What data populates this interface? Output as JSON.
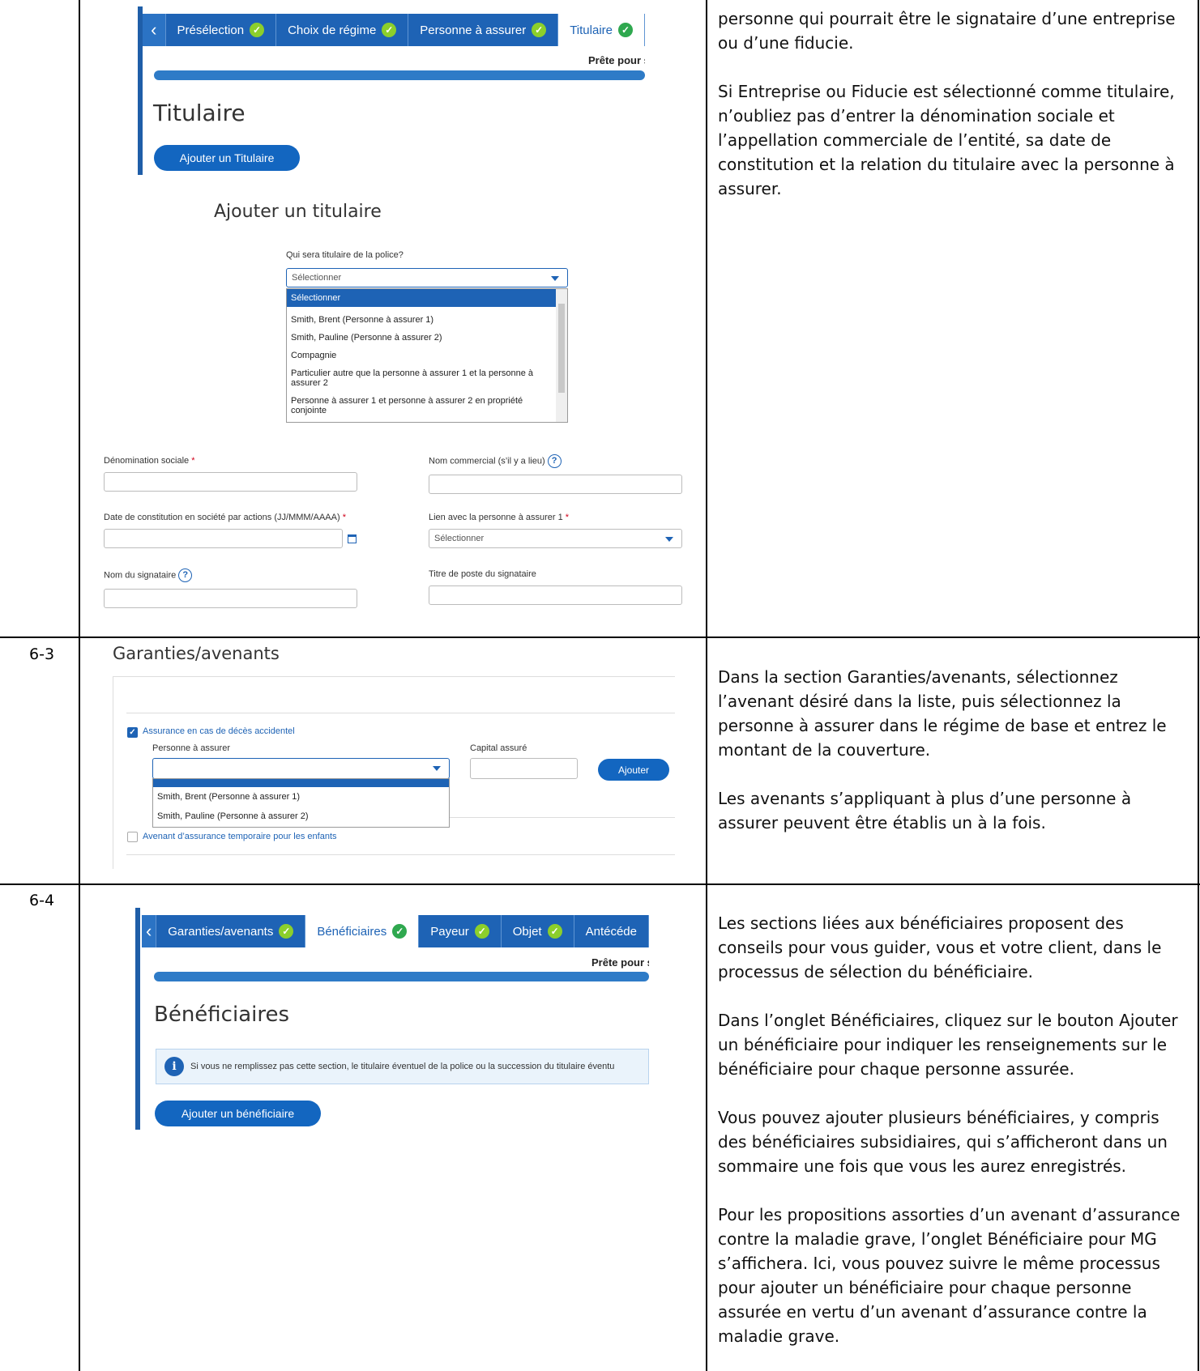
{
  "rows": [
    {
      "number": ""
    },
    {
      "number": "6-3"
    },
    {
      "number": "6-4"
    }
  ],
  "row1": {
    "desc": [
      "personne qui pourrait être le signataire d’une entreprise ou d’une fiducie.",
      "Si Entreprise ou Fiducie est sélectionné comme titulaire, n’oubliez pas d’entrer la dénomination sociale et l’appellation commerciale de l’entité, sa date de constitution et la relation du titulaire avec la personne à assurer."
    ],
    "tabs": [
      "Présélection",
      "Choix de régime",
      "Personne à assurer",
      "Titulaire"
    ],
    "ready": "Prête pour s",
    "page_title": "Titulaire",
    "add_button": "Ajouter un Titulaire",
    "modal_title": "Ajouter un titulaire",
    "question": "Qui sera titulaire de la police?",
    "select_value": "Sélectionner",
    "options": [
      "Sélectionner",
      "Smith, Brent (Personne à assurer 1)",
      "Smith, Pauline (Personne à assurer 2)",
      "Compagnie",
      "Particulier autre que la personne à assurer 1 et la personne à assurer 2",
      "Personne à assurer 1 et personne à assurer 2 en propriété conjointe"
    ],
    "fields": {
      "denomination": "Dénomination sociale",
      "nom_commercial": "Nom commercial (s’il y a lieu)",
      "date_constitution": "Date de constitution en société par actions (JJ/MMM/AAAA)",
      "lien": "Lien avec la personne à assurer 1",
      "lien_value": "Sélectionner",
      "nom_signataire": "Nom du signataire",
      "titre_poste": "Titre de poste du signataire"
    }
  },
  "row2": {
    "heading": "Garanties/avenants",
    "desc": [
      "Dans la section Garanties/avenants, sélectionnez l’avenant désiré dans la liste, puis sélectionnez la personne à assurer dans le régime de base et entrez le montant de la couverture.",
      "Les avenants s’appliquant à plus d’une personne à assurer peuvent être établis un à la fois."
    ],
    "rider1": "Assurance en cas de décès accidentel",
    "person_label": "Personne à assurer",
    "capital_label": "Capital assuré",
    "add_label": "Ajouter",
    "persons": [
      "Smith, Brent (Personne à assurer 1)",
      "Smith, Pauline (Personne à assurer 2)"
    ],
    "rider2": "Avenant d’assurance temporaire pour les enfants"
  },
  "row3": {
    "desc": [
      "Les sections liées aux bénéficiaires proposent des conseils pour vous guider, vous et votre client, dans le processus de sélection du bénéficiaire.",
      "Dans l’onglet Bénéficiaires, cliquez sur le bouton Ajouter un bénéficiaire pour indiquer les renseignements sur le bénéficiaire pour chaque personne assurée.",
      "Vous pouvez ajouter plusieurs bénéficiaires, y compris des bénéficiaires subsidiaires, qui s’afficheront dans un sommaire une fois que vous les aurez enregistrés.",
      "Pour les propositions assorties d’un avenant d’assurance contre la maladie grave, l’onglet Bénéficiaire pour MG s’affichera. Ici, vous pouvez suivre le même processus pour ajouter un bénéficiaire pour chaque personne assurée en vertu d’un avenant d’assurance contre la maladie grave."
    ],
    "tabs": [
      "Garanties/avenants",
      "Bénéficiaires",
      "Payeur",
      "Objet",
      "Antécéde"
    ],
    "ready": "Prête pour s",
    "page_title": "Bénéficiaires",
    "info": "Si vous ne remplissez pas cette section, le titulaire éventuel de la police ou la succession du titulaire éventu",
    "add_button": "Ajouter un bénéficiaire"
  }
}
